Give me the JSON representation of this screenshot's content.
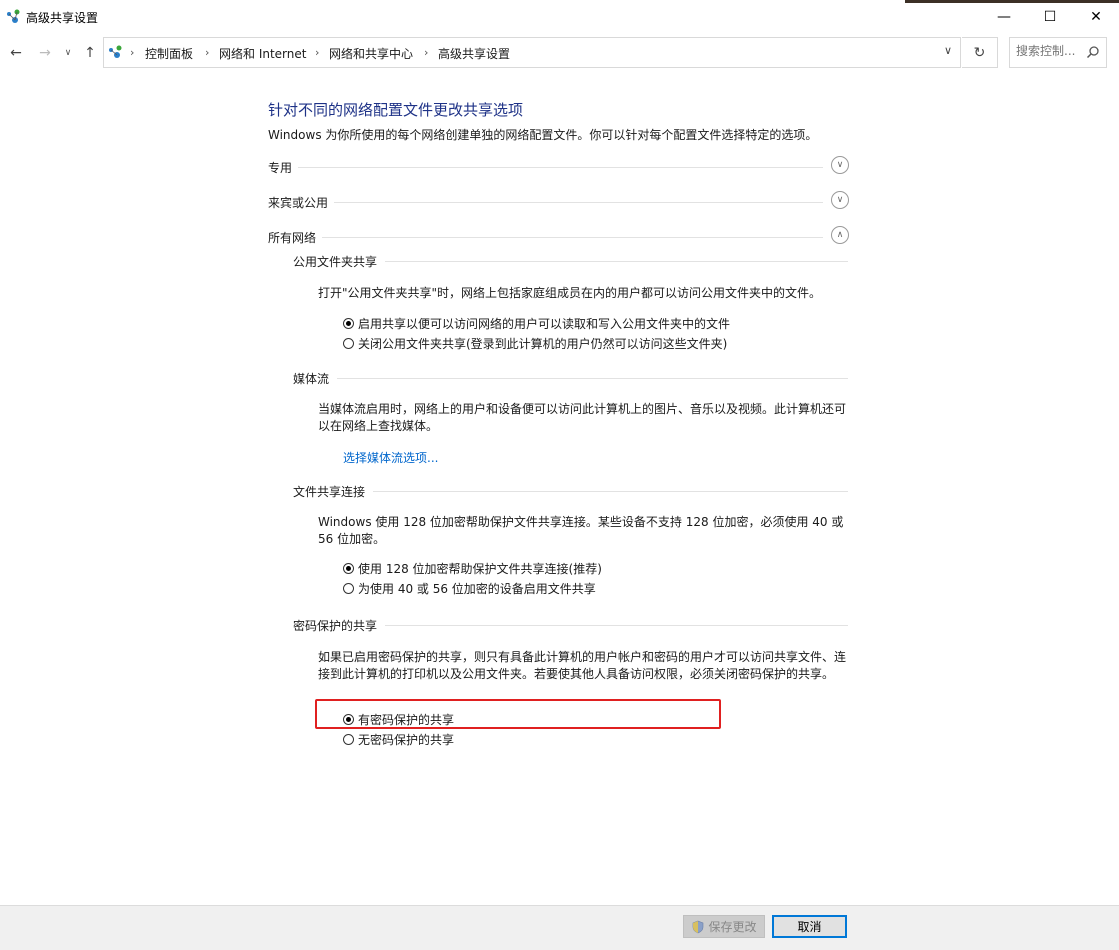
{
  "window": {
    "title": "高级共享设置",
    "min_glyph": "—",
    "max_glyph": "☐",
    "close_glyph": "✕"
  },
  "nav": {
    "breadcrumb": [
      "控制面板",
      "网络和 Internet",
      "网络和共享中心",
      "高级共享设置"
    ],
    "search_placeholder": "搜索控制..."
  },
  "content": {
    "title": "针对不同的网络配置文件更改共享选项",
    "description": "Windows 为你所使用的每个网络创建单独的网络配置文件。你可以针对每个配置文件选择特定的选项。",
    "profiles": [
      {
        "label": "专用",
        "expanded": false
      },
      {
        "label": "来宾或公用",
        "expanded": false
      },
      {
        "label": "所有网络",
        "expanded": true
      }
    ],
    "public_folder": {
      "heading": "公用文件夹共享",
      "text": "打开\"公用文件夹共享\"时，网络上包括家庭组成员在内的用户都可以访问公用文件夹中的文件。",
      "options": [
        {
          "label": "启用共享以便可以访问网络的用户可以读取和写入公用文件夹中的文件",
          "selected": true
        },
        {
          "label": "关闭公用文件夹共享(登录到此计算机的用户仍然可以访问这些文件夹)",
          "selected": false
        }
      ]
    },
    "media": {
      "heading": "媒体流",
      "text": "当媒体流启用时，网络上的用户和设备便可以访问此计算机上的图片、音乐以及视频。此计算机还可以在网络上查找媒体。",
      "link": "选择媒体流选项..."
    },
    "file_sharing": {
      "heading": "文件共享连接",
      "text": "Windows 使用 128 位加密帮助保护文件共享连接。某些设备不支持 128 位加密，必须使用 40 或 56 位加密。",
      "options": [
        {
          "label": "使用 128 位加密帮助保护文件共享连接(推荐)",
          "selected": true
        },
        {
          "label": "为使用 40 或 56 位加密的设备启用文件共享",
          "selected": false
        }
      ]
    },
    "password": {
      "heading": "密码保护的共享",
      "text": "如果已启用密码保护的共享，则只有具备此计算机的用户帐户和密码的用户才可以访问共享文件、连接到此计算机的打印机以及公用文件夹。若要使其他人具备访问权限，必须关闭密码保护的共享。",
      "options": [
        {
          "label": "有密码保护的共享",
          "selected": true
        },
        {
          "label": "无密码保护的共享",
          "selected": false
        }
      ]
    }
  },
  "footer": {
    "save_label": "保存更改",
    "cancel_label": "取消"
  },
  "colors": {
    "title_blue": "#1e3287",
    "link_blue": "#0066cc",
    "highlight_red": "#e02020",
    "accent": "#0078d7"
  }
}
